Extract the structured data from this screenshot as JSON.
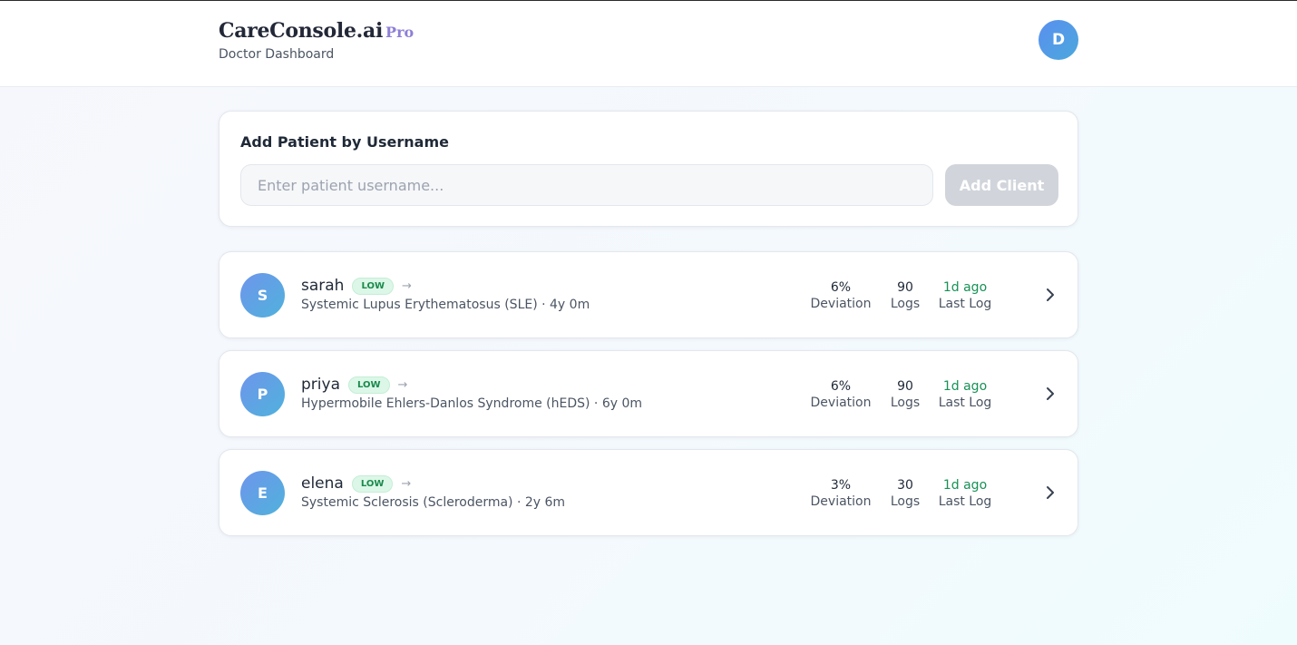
{
  "header": {
    "brand": "CareConsole.ai",
    "brand_badge": "Pro",
    "subtitle": "Doctor Dashboard",
    "user_initial": "D"
  },
  "add_patient": {
    "title": "Add Patient by Username",
    "input_placeholder": "Enter patient username...",
    "input_value": "",
    "button_label": "Add Client"
  },
  "patients": [
    {
      "initial": "S",
      "name": "sarah",
      "risk": "LOW",
      "trend": "→",
      "condition": "Systemic Lupus Erythematosus (SLE) · 4y 0m",
      "deviation": "6%",
      "deviation_label": "Deviation",
      "logs": "90",
      "logs_label": "Logs",
      "last_log": "1d ago",
      "last_log_label": "Last Log"
    },
    {
      "initial": "P",
      "name": "priya",
      "risk": "LOW",
      "trend": "→",
      "condition": "Hypermobile Ehlers-Danlos Syndrome (hEDS) · 6y 0m",
      "deviation": "6%",
      "deviation_label": "Deviation",
      "logs": "90",
      "logs_label": "Logs",
      "last_log": "1d ago",
      "last_log_label": "Last Log"
    },
    {
      "initial": "E",
      "name": "elena",
      "risk": "LOW",
      "trend": "→",
      "condition": "Systemic Sclerosis (Scleroderma) · 2y 6m",
      "deviation": "3%",
      "deviation_label": "Deviation",
      "logs": "30",
      "logs_label": "Logs",
      "last_log": "1d ago",
      "last_log_label": "Last Log"
    }
  ],
  "icons": {
    "row_action": "chevron-right-icon"
  },
  "colors": {
    "accent": "#8e7fd6",
    "avatar_start": "#5b8ff0",
    "avatar_end": "#4aa8dc",
    "risk_low_bg": "#dcf7e7",
    "risk_low_text": "#1a8a4c",
    "last_log_text": "#169155",
    "button_disabled": "#d1d5db"
  }
}
